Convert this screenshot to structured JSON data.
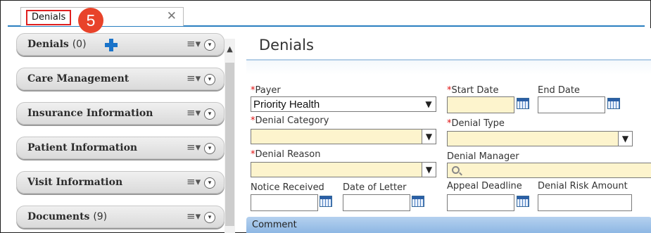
{
  "tab": {
    "label": "Denials",
    "close_glyph": "✕"
  },
  "step_badge": "5",
  "panels": [
    {
      "title": "Denials",
      "count": "(0)",
      "has_add": true
    },
    {
      "title": "Care Management",
      "count": ""
    },
    {
      "title": "Insurance Information",
      "count": ""
    },
    {
      "title": "Patient Information",
      "count": ""
    },
    {
      "title": "Visit Information",
      "count": ""
    },
    {
      "title": "Documents",
      "count": "(9)"
    }
  ],
  "panel_menu_glyph": "≡▾",
  "panel_chevron_glyph": "▾",
  "content": {
    "title": "Denials",
    "fields": {
      "payer": {
        "label": "Payer",
        "value": "Priority Health"
      },
      "start_date": {
        "label": "Start Date",
        "value": ""
      },
      "end_date": {
        "label": "End Date",
        "value": ""
      },
      "denial_category": {
        "label": "Denial Category",
        "value": ""
      },
      "denial_type": {
        "label": "Denial Type",
        "value": ""
      },
      "denial_reason": {
        "label": "Denial Reason",
        "value": ""
      },
      "denial_manager": {
        "label": "Denial Manager",
        "value": ""
      },
      "notice_received": {
        "label": "Notice Received",
        "value": ""
      },
      "date_of_letter": {
        "label": "Date of Letter",
        "value": ""
      },
      "appeal_deadline": {
        "label": "Appeal Deadline",
        "value": ""
      },
      "denial_risk_amount": {
        "label": "Denial Risk Amount",
        "value": ""
      }
    },
    "comment_label": "Comment",
    "required_marker": "*"
  },
  "colors": {
    "accent": "#2a7fc0",
    "required": "#e01010",
    "badge": "#e8432a",
    "highlight_border": "#e02020",
    "required_field_bg": "#fdf4cd"
  }
}
